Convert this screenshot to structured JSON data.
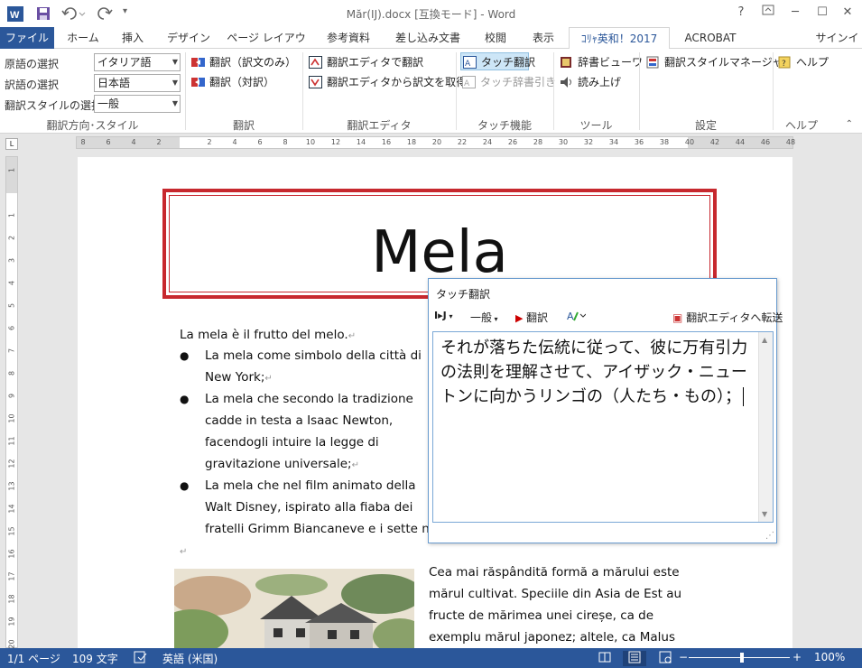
{
  "window": {
    "title": "Măr(IJ).docx [互換モード] - Word",
    "help": "?",
    "signin": "サインイン"
  },
  "tabs": [
    {
      "label": "ファイル"
    },
    {
      "label": "ホーム"
    },
    {
      "label": "挿入"
    },
    {
      "label": "デザイン"
    },
    {
      "label": "ページ レイアウト"
    },
    {
      "label": "参考資料"
    },
    {
      "label": "差し込み文書"
    },
    {
      "label": "校閲"
    },
    {
      "label": "表示"
    },
    {
      "label": "ｺﾘｬ英和！2017"
    },
    {
      "label": "ACROBAT"
    }
  ],
  "ribbon": {
    "direction": {
      "source_label": "原語の選択",
      "source_value": "イタリア語",
      "target_label": "訳語の選択",
      "target_value": "日本語",
      "style_label": "翻訳スタイルの選択",
      "style_value": "一般",
      "group": "翻訳方向･スタイル"
    },
    "translate": {
      "btn1": "翻訳（訳文のみ）",
      "btn2": "翻訳（対訳）",
      "group": "翻訳"
    },
    "editor": {
      "btn1": "翻訳エディタで翻訳",
      "btn2": "翻訳エディタから訳文を取得",
      "group": "翻訳エディタ"
    },
    "touch": {
      "btn1": "タッチ翻訳",
      "btn2": "タッチ辞書引き",
      "group": "タッチ機能"
    },
    "tools": {
      "btn1": "辞書ビューワ",
      "btn2": "読み上げ",
      "group": "ツール"
    },
    "settings": {
      "btn1": "翻訳スタイルマネージャ",
      "group": "設定"
    },
    "help": {
      "btn1": "ヘルプ",
      "group": "ヘルプ"
    }
  },
  "ruler": {
    "h": [
      "8",
      "6",
      "4",
      "2",
      "",
      "2",
      "4",
      "6",
      "8",
      "10",
      "12",
      "14",
      "16",
      "18",
      "20",
      "22",
      "24",
      "26",
      "28",
      "30",
      "32",
      "34",
      "36",
      "38",
      "40",
      "42",
      "44",
      "46",
      "48"
    ],
    "v": [
      "1",
      "",
      "1",
      "2",
      "3",
      "4",
      "5",
      "6",
      "7",
      "8",
      "9",
      "10",
      "11",
      "12",
      "13",
      "14",
      "15",
      "16",
      "17",
      "18",
      "19",
      "20"
    ]
  },
  "doc": {
    "title": "Mela",
    "intro": "La mela è il frutto del melo.",
    "b1a": "La mela come simbolo della città di",
    "b1b": "New York;",
    "b2a": "La mela che secondo la tradizione",
    "b2b": "cadde in testa a Isaac Newton,",
    "b2c": "facendogli intuire la legge di",
    "b2d": "gravitazione universale;",
    "b3a": "La mela che nel film animato della",
    "b3b": "Walt Disney, ispirato alla fiaba dei",
    "b3c": "fratelli Grimm Biancaneve e i sette na",
    "ro1": "Cea mai răspândită formă a mărului este",
    "ro2": "mărul cultivat. Speciile din Asia de Est au",
    "ro3": "fructe de mărimea unei cireșe, ca de",
    "ro4": "exemplu mărul japonez; altele, ca Malus"
  },
  "dialog": {
    "title": "タッチ翻訳",
    "dir": "I▸J",
    "style": "一般",
    "translate": "翻訳",
    "send": "翻訳エディタへ転送",
    "output": "それが落ちた伝統に従って、彼に万有引力の法則を理解させて、アイザック・ニュートンに向かうリンゴの（人たち・もの）；"
  },
  "status": {
    "page": "1/1 ページ",
    "words": "109 文字",
    "lang": "英語 (米国)",
    "zoom": "100%",
    "zoom_percent": 100
  },
  "colors": {
    "accent": "#2b579a",
    "frame": "#c7282e"
  }
}
